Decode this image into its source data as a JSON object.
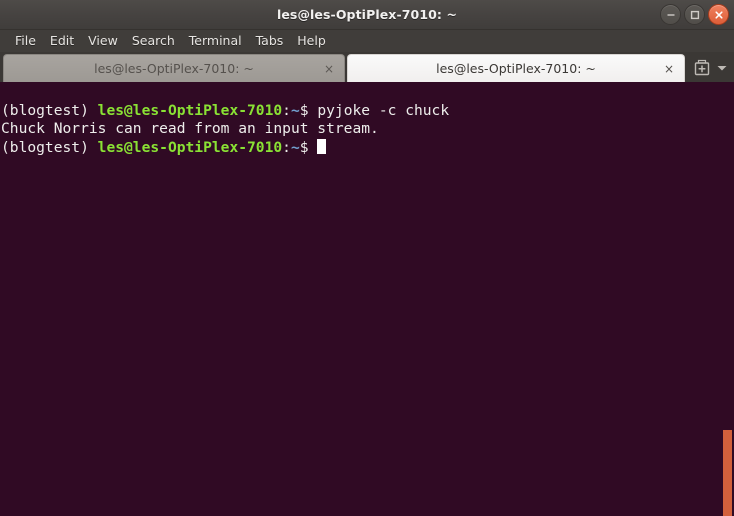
{
  "window": {
    "title": "les@les-OptiPlex-7010: ~",
    "controls": {
      "minimize": "minimize",
      "maximize": "maximize",
      "close": "close"
    }
  },
  "menubar": {
    "items": [
      {
        "label": "File"
      },
      {
        "label": "Edit"
      },
      {
        "label": "View"
      },
      {
        "label": "Search"
      },
      {
        "label": "Terminal"
      },
      {
        "label": "Tabs"
      },
      {
        "label": "Help"
      }
    ]
  },
  "tabbar": {
    "tabs": [
      {
        "label": "les@les-OptiPlex-7010: ~",
        "close": "×",
        "active": false
      },
      {
        "label": "les@les-OptiPlex-7010: ~",
        "close": "×",
        "active": true
      }
    ],
    "new_tab_icon": "new-terminal-icon",
    "tab_menu_icon": "chevron-down-icon"
  },
  "terminal": {
    "colors": {
      "background": "#300a24",
      "foreground": "#eeeeec",
      "prompt_user_host": "#8ae234",
      "prompt_path": "#729fcf",
      "cursor": "#ffffff",
      "scrollbar": "#d2603c"
    },
    "lines": [
      {
        "segments": [
          {
            "text": "(blogtest) ",
            "color": "white"
          },
          {
            "text": "les@les-OptiPlex-7010",
            "color": "green"
          },
          {
            "text": ":",
            "color": "white"
          },
          {
            "text": "~",
            "color": "blue"
          },
          {
            "text": "$ pyjoke -c chuck",
            "color": "white"
          }
        ]
      },
      {
        "segments": [
          {
            "text": "Chuck Norris can read from an input stream.",
            "color": "white"
          }
        ]
      },
      {
        "segments": [
          {
            "text": "(blogtest) ",
            "color": "white"
          },
          {
            "text": "les@les-OptiPlex-7010",
            "color": "green"
          },
          {
            "text": ":",
            "color": "white"
          },
          {
            "text": "~",
            "color": "blue"
          },
          {
            "text": "$ ",
            "color": "white"
          }
        ],
        "cursor": true
      }
    ],
    "prompt_env": "(blogtest)",
    "prompt_user_host": "les@les-OptiPlex-7010",
    "prompt_path": "~",
    "prompt_symbol": "$",
    "command": "pyjoke -c chuck",
    "output": "Chuck Norris can read from an input stream."
  },
  "scrollbar": {
    "thumb_top_percent": 80,
    "thumb_height_percent": 20
  }
}
